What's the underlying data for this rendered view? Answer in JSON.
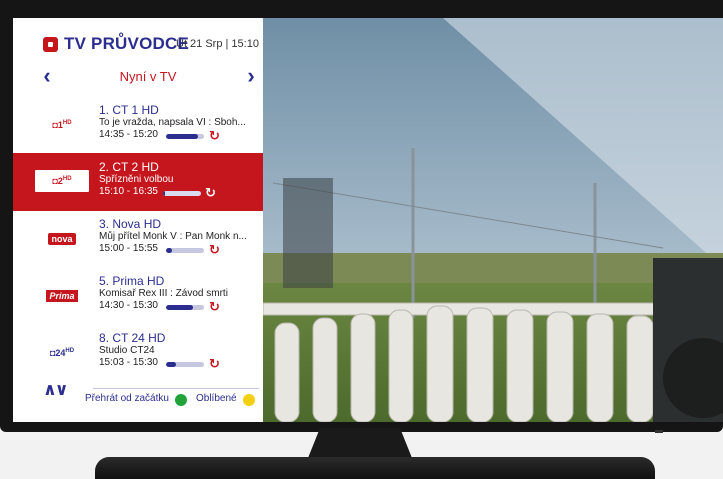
{
  "guide": {
    "logo_text": "TV PRŮVODCE",
    "datetime": "Út 21 Srp | 15:10",
    "nav_title": "Nyní v TV",
    "prev_icon": "chevron-left-icon",
    "next_icon": "chevron-right-icon"
  },
  "channels": [
    {
      "logo": "CT1 HD",
      "name": "1. CT 1 HD",
      "show": "To je vražda, napsala VI : Sboh...",
      "time": "14:35 - 15:20",
      "progress": 0.85,
      "active": false
    },
    {
      "logo": "CT2 HD",
      "name": "2. CT 2 HD",
      "show": "Spřízněni volbou",
      "time": "15:10 - 16:35",
      "progress": 0.05,
      "active": true
    },
    {
      "logo": "nova",
      "name": "3. Nova HD",
      "show": "Můj přítel Monk V : Pan Monk n...",
      "time": "15:00 - 15:55",
      "progress": 0.15,
      "active": false
    },
    {
      "logo": "Prima",
      "name": "5. Prima HD",
      "show": "Komisař Rex III : Závod smrti",
      "time": "14:30 - 15:30",
      "progress": 0.7,
      "active": false
    },
    {
      "logo": "CT24",
      "name": "8. CT 24 HD",
      "show": "Studio CT24",
      "time": "15:03 - 15:30",
      "progress": 0.25,
      "active": false
    }
  ],
  "footer": {
    "updown_icon": "up-down-arrows-icon",
    "restart_label": "Přehrát od začátku",
    "restart_color": "#21a33a",
    "favorites_label": "Oblíbené",
    "favorites_color": "#f2cf0f"
  },
  "colors": {
    "brand_red": "#c5161d",
    "brand_blue": "#2b2e8f"
  }
}
